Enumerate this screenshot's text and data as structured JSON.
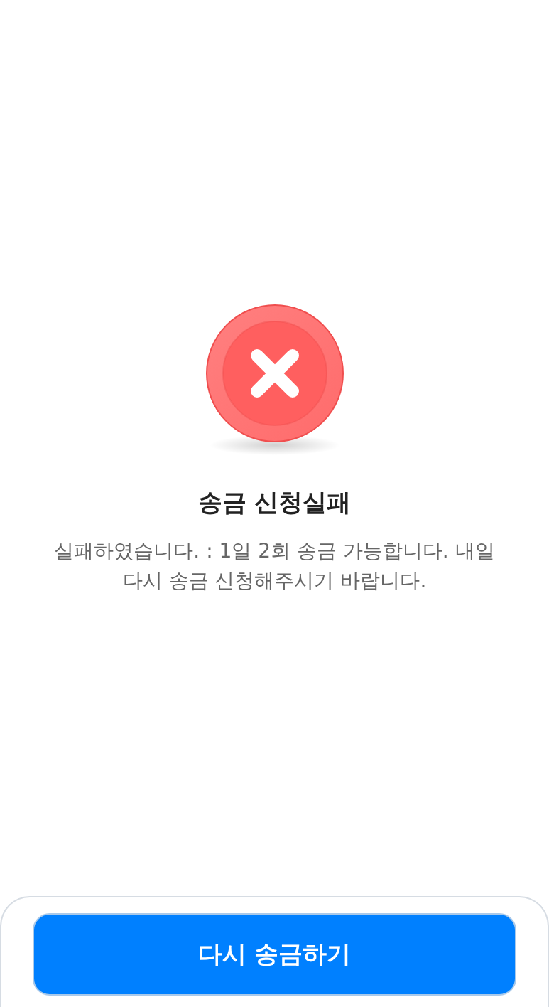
{
  "result": {
    "kind": "failure",
    "title": "송금 신청실패",
    "message": "실패하였습니다. : 1일 2회 송금 가능합니다. 내일 다시 송금 신청해주시기 바랍니다."
  },
  "actions": {
    "retry_button": "다시 송금하기"
  }
}
